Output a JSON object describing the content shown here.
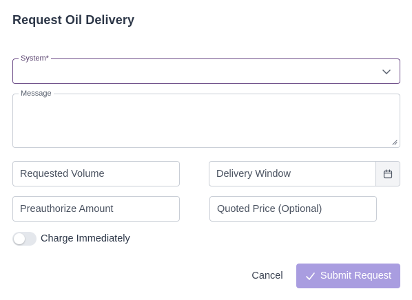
{
  "dialog": {
    "title": "Request Oil Delivery"
  },
  "form": {
    "system_label": "System*",
    "message_label": "Message",
    "volume_placeholder": "Requested Volume",
    "window_placeholder": "Delivery Window",
    "preauth_placeholder": "Preauthorize Amount",
    "quoted_placeholder": "Quoted Price (Optional)",
    "charge_label": "Charge Immediately",
    "charge_enabled": false
  },
  "actions": {
    "cancel_label": "Cancel",
    "submit_label": "Submit Request"
  },
  "icons": {
    "select": "chevron-down-icon",
    "calendar": "calendar-icon",
    "submit": "check-icon"
  },
  "colors": {
    "focus_border": "#6b4a86",
    "submit_bg": "#a99de0",
    "toggle_off": "#e4e7ec"
  }
}
